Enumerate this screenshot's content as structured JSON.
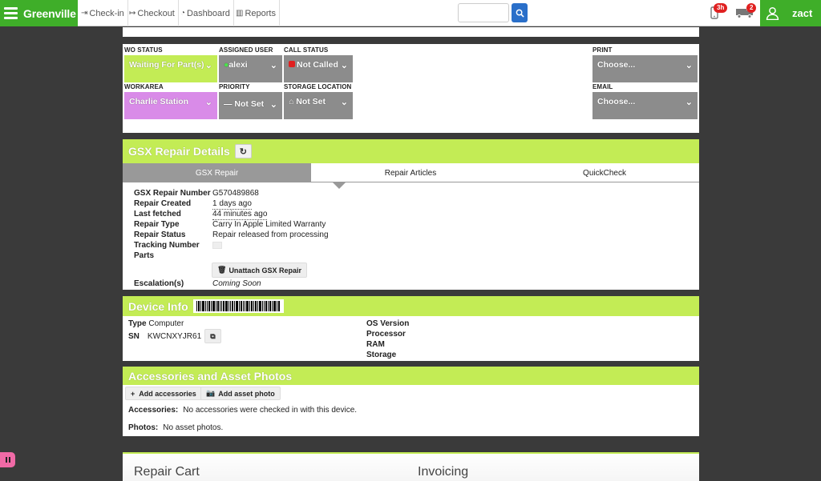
{
  "nav": {
    "brand": "Greenville",
    "links": [
      {
        "icon": "sign-in-icon",
        "glyph": "⇥",
        "label": "Check-in"
      },
      {
        "icon": "sign-out-icon",
        "glyph": "↦",
        "label": "Checkout"
      },
      {
        "icon": "dashboard-icon",
        "glyph": "◔",
        "label": "Dashboard"
      },
      {
        "icon": "bar-chart-icon",
        "glyph": "▥",
        "label": "Reports"
      }
    ],
    "search_placeholder": "",
    "phone_badge": "3h",
    "truck_badge": "2",
    "username": "zact"
  },
  "status": {
    "wo_status": {
      "label": "WO Status",
      "value": "Waiting For Part(s)"
    },
    "assigned_user": {
      "label": "Assigned User",
      "value": "alexi"
    },
    "call_status": {
      "label": "Call Status",
      "value": "Not Called"
    },
    "print": {
      "label": "Print",
      "value": "Choose..."
    },
    "workarea": {
      "label": "Workarea",
      "value": "Charlie Station"
    },
    "priority": {
      "label": "Priority",
      "value": "Not Set"
    },
    "storage_location": {
      "label": "Storage Location",
      "value": "Not Set"
    },
    "email": {
      "label": "Email",
      "value": "Choose..."
    }
  },
  "gsx": {
    "title": "GSX Repair Details",
    "tabs": [
      "GSX Repair",
      "Repair Articles",
      "QuickCheck"
    ],
    "fields": [
      {
        "key": "GSX Repair Number",
        "value": "G570489868"
      },
      {
        "key": "Repair Created",
        "value": "1 days ago"
      },
      {
        "key": "Last fetched",
        "value": "44 minutes ago"
      },
      {
        "key": "Repair Type",
        "value": "Carry In Apple Limited Warranty"
      },
      {
        "key": "Repair Status",
        "value": "Repair released from processing"
      },
      {
        "key": "Tracking Number",
        "value": ""
      },
      {
        "key": "Parts",
        "value": ""
      }
    ],
    "unattach_label": "Unattach GSX Repair",
    "escalation_key": "Escalation(s)",
    "escalation_value": "Coming Soon"
  },
  "device": {
    "title": "Device Info",
    "type_key": "Type",
    "type_value": "Computer",
    "sn_key": "SN",
    "sn_value": "KWCNXYJR61",
    "right_keys": [
      "OS Version",
      "Processor",
      "RAM",
      "Storage"
    ]
  },
  "accessories": {
    "title": "Accessories and Asset Photos",
    "add_accessories": "Add accessories",
    "add_photo": "Add asset photo",
    "acc_key": "Accessories:",
    "acc_value": "No accessories were checked in with this device.",
    "photos_key": "Photos:",
    "photos_value": "No asset photos."
  },
  "cart": {
    "repair_cart": "Repair Cart",
    "invoicing": "Invoicing"
  },
  "colors": {
    "brand_green": "#3fae29",
    "lime": "#c3ec55",
    "violet": "#d98be8",
    "gray": "#8c8c8c",
    "search_blue": "#2a6fc9"
  }
}
